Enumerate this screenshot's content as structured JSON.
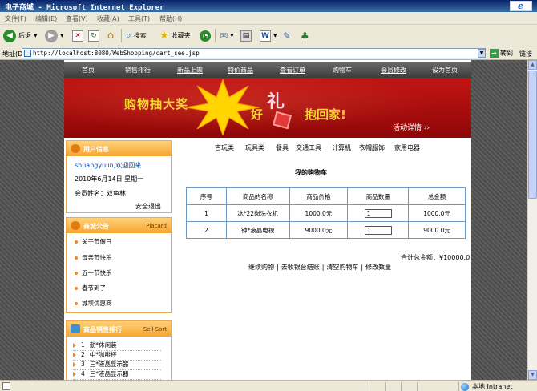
{
  "window": {
    "title": "电子商城 - Microsoft Internet Explorer"
  },
  "menu": [
    "文件(F)",
    "编辑(E)",
    "查看(V)",
    "收藏(A)",
    "工具(T)",
    "帮助(H)"
  ],
  "toolbar": {
    "back": "后退",
    "search": "搜索",
    "favorites": "收藏夹"
  },
  "address": {
    "label": "地址(D)",
    "url": "http://localhost:8080/WebShopping/cart_see.jsp",
    "go": "转到",
    "links": "链接"
  },
  "site_nav": [
    "首页",
    "销售排行",
    "新品上架",
    "特价商品",
    "查看订单",
    "购物车",
    "会员修改",
    "设为首页"
  ],
  "banner": {
    "line1": "购物抽大奖",
    "good": "好",
    "gift": "礼",
    "line2": "抱回家!",
    "more": "活动详情 ››"
  },
  "user_box": {
    "title": "用户信息",
    "greeting": "shuangyulin,欢迎回来",
    "date": "2010年6月14日 星期一",
    "member": "会员姓名：双鱼林",
    "logout": "安全退出"
  },
  "notice_box": {
    "title": "商城公告",
    "title_en": "Placard",
    "items": [
      "关于节假日",
      "母亲节快乐",
      "五一节快乐",
      "春节到了",
      "城坝优惠商"
    ]
  },
  "rank_box": {
    "title": "商品销售排行",
    "title_en": "Sell Sort",
    "items": [
      {
        "no": "1",
        "name": "勤*休闲装"
      },
      {
        "no": "2",
        "name": "中*咖啡杯"
      },
      {
        "no": "3",
        "name": "三*液晶显示器"
      },
      {
        "no": "4",
        "name": "三*液晶显示器"
      }
    ]
  },
  "categories": [
    "古玩类",
    "玩具类",
    "餐具",
    "交通工具",
    "计算机",
    "衣帽服饰",
    "家用电器"
  ],
  "cart": {
    "title": "我的购物车",
    "headers": [
      "序号",
      "商品的名称",
      "商品价格",
      "商品数量",
      "总金额"
    ],
    "rows": [
      {
        "no": "1",
        "name": "冰*22岗洗衣机",
        "price": "1000.0元",
        "qty": "1",
        "total": "1000.0元"
      },
      {
        "no": "2",
        "name": "钟*液晶电视",
        "price": "9000.0元",
        "qty": "1",
        "total": "9000.0元"
      }
    ],
    "grand_total": "合计总金额：¥10000.0",
    "actions": [
      "继续购物",
      "去收银台结账",
      "清空购物车",
      "修改数量"
    ]
  },
  "status": {
    "zone": "本地 Intranet"
  }
}
